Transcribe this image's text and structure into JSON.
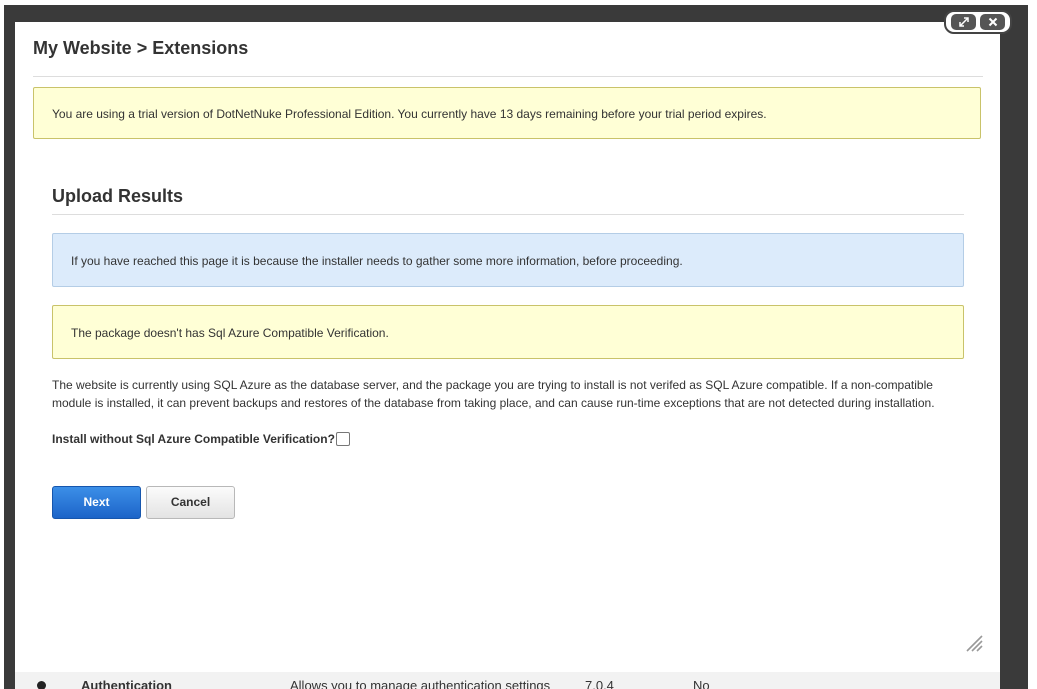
{
  "modal": {
    "title": "My Website > Extensions",
    "trial_notice": "You are using a trial version of DotNetNuke Professional Edition. You currently have 13 days remaining before your trial period expires.",
    "section_title": "Upload Results",
    "info_message": "If you have reached this page it is because the installer needs to gather some more information, before proceeding.",
    "warning_message": "The package doesn't has Sql Azure Compatible Verification.",
    "description": "The website is currently using SQL Azure as the database server, and the package you are trying to install is not verifed as SQL Azure compatible. If a non-compatible module is installed, it can prevent backups and restores of the database from taking place, and can cause run-time exceptions that are not detected during installation.",
    "install_label": "Install without Sql Azure Compatible Verification?",
    "install_checked": false,
    "next_label": "Next",
    "cancel_label": "Cancel",
    "controls": {
      "maximize_icon": "maximize-icon",
      "close_icon": "close-icon"
    }
  },
  "background_row": {
    "name": "Authentication",
    "description": "Allows you to manage authentication settings",
    "version": "7.0.4",
    "flag": "No"
  },
  "colors": {
    "notice_bg": "#ffffd6",
    "info_bg": "#dcebfb",
    "primary_button": "#1c64c8"
  }
}
